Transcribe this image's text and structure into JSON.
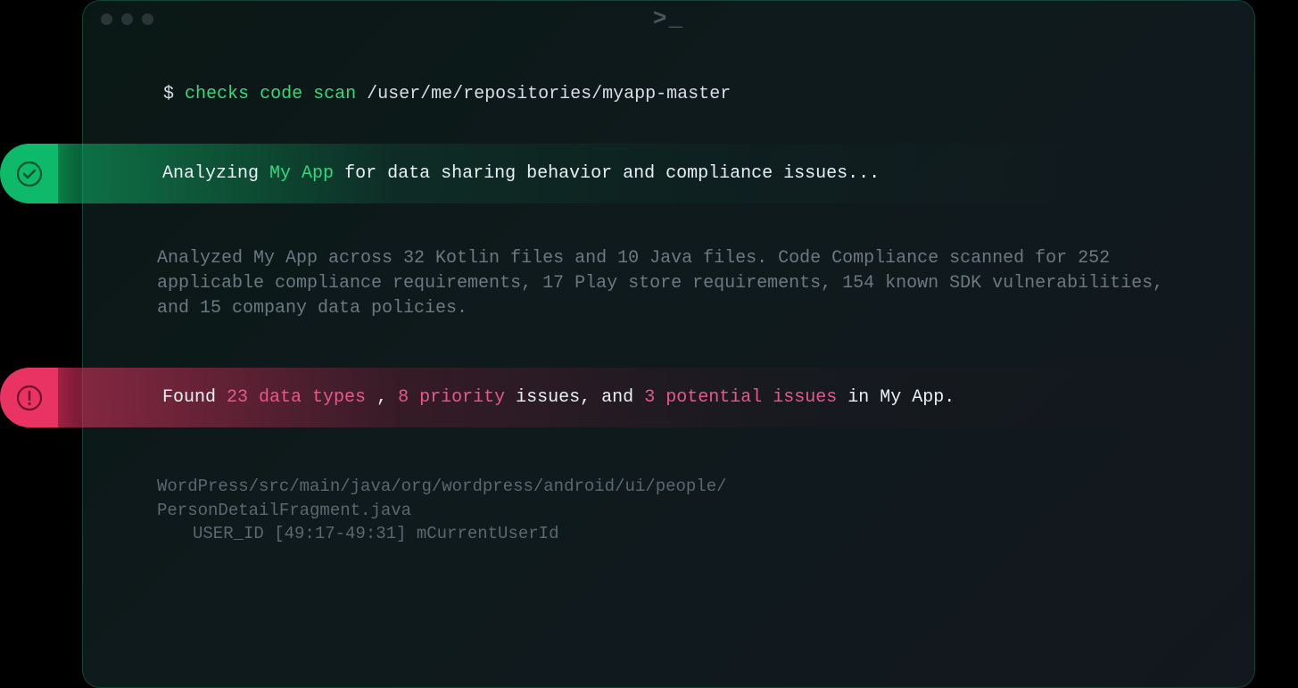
{
  "titlebar": {
    "prompt_symbol": ">_"
  },
  "command": {
    "prompt": "$",
    "cmd1": "checks",
    "cmd2": "code",
    "cmd3": "scan",
    "path": "/user/me/repositories/myapp-master"
  },
  "analyzing": {
    "prefix": "Analyzing",
    "app_name": "My App",
    "suffix": "for data sharing behavior and compliance issues..."
  },
  "analysis": {
    "text": "Analyzed My App across 32 Kotlin files and 10 Java files. Code Compliance scanned for 252 applicable compliance requirements, 17 Play store requirements, 154 known SDK vulnerabilities, and 15 company data policies."
  },
  "findings": {
    "prefix": "Found",
    "data_types": "23 data types",
    "sep1": ",",
    "priority": "8 priority",
    "mid": "issues, and",
    "potential": "3 potential issues",
    "suffix": "in My App."
  },
  "output": {
    "line1": "WordPress/src/main/java/org/wordpress/android/ui/people/",
    "line2": "PersonDetailFragment.java",
    "line3": "USER_ID [49:17-49:31] mCurrentUserId"
  }
}
